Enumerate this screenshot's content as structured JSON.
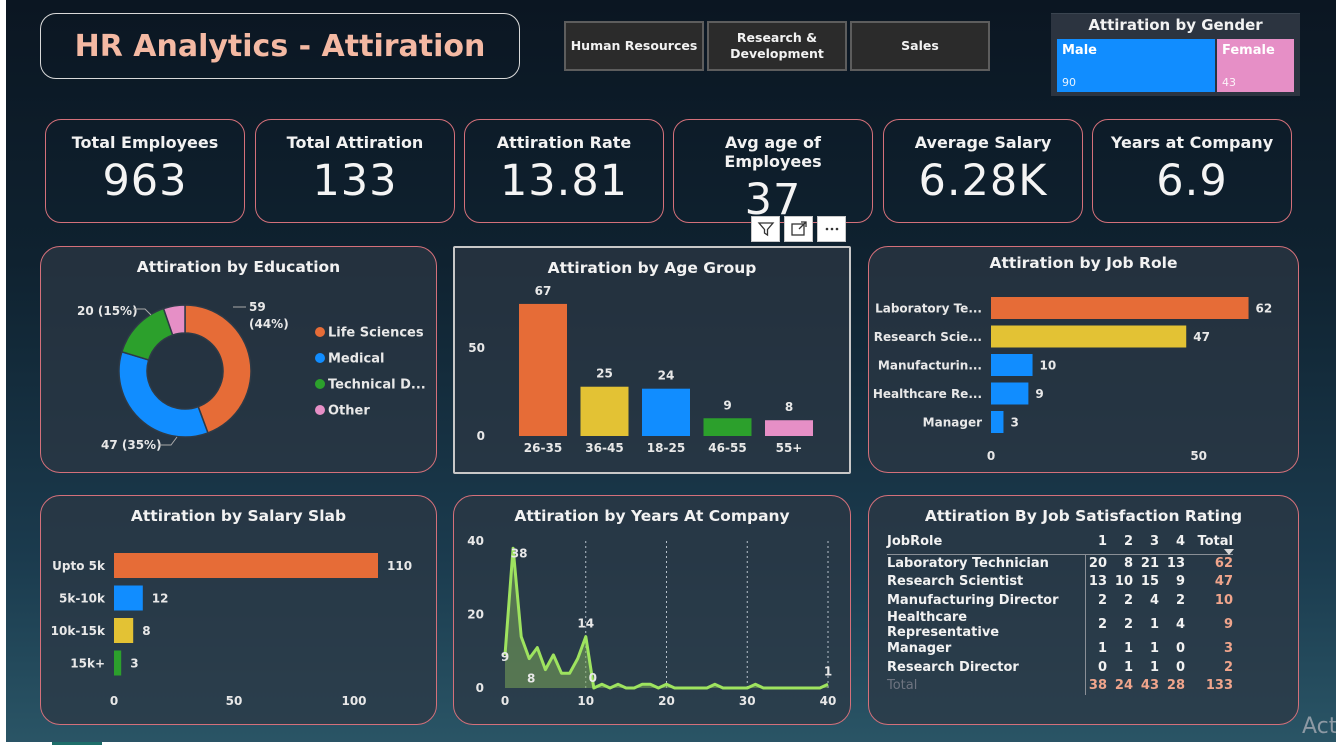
{
  "title": "HR Analytics - Attiration",
  "departments": [
    "Human Resources",
    "Research &\nDevelopment",
    "Sales"
  ],
  "gender": {
    "title": "Attiration by Gender",
    "items": [
      {
        "label": "Male",
        "value": 90,
        "color": "#118dff"
      },
      {
        "label": "Female",
        "value": 43,
        "color": "#e68fc6"
      }
    ]
  },
  "kpis": [
    {
      "label": "Total Employees",
      "value": "963"
    },
    {
      "label": "Total Attiration",
      "value": "133"
    },
    {
      "label": "Attiration Rate",
      "value": "13.81"
    },
    {
      "label": "Avg age of Employees",
      "value": "37"
    },
    {
      "label": "Average Salary",
      "value": "6.28K"
    },
    {
      "label": "Years at Company",
      "value": "6.9"
    }
  ],
  "visual_toolbar": [
    "filter-icon",
    "focus-mode-icon",
    "more-options-icon"
  ],
  "watermark": "Act",
  "chart_data": [
    {
      "type": "pie",
      "title": "Attiration by Education",
      "categories": [
        "Life Sciences",
        "Medical",
        "Technical D...",
        "Other"
      ],
      "values": [
        59,
        47,
        20,
        7
      ],
      "labels": [
        "59\n(44%)",
        "47 (35%)",
        "20 (15%)",
        ""
      ],
      "colors": [
        "#e66c37",
        "#118dff",
        "#2ca02c",
        "#e68fc6"
      ],
      "legend": "right"
    },
    {
      "type": "bar",
      "title": "Attiration by Age Group",
      "categories": [
        "26-35",
        "36-45",
        "18-25",
        "46-55",
        "55+"
      ],
      "values": [
        67,
        25,
        24,
        9,
        8
      ],
      "colors": [
        "#e66c37",
        "#e3c234",
        "#118dff",
        "#2ca02c",
        "#e68fc6"
      ],
      "yticks": [
        "0",
        "50"
      ],
      "ylim": [
        0,
        70
      ]
    },
    {
      "type": "bar",
      "orientation": "horizontal",
      "title": "Attiration by Job Role",
      "categories": [
        "Laboratory Te...",
        "Research Scie...",
        "Manufacturin...",
        "Healthcare Re...",
        "Manager"
      ],
      "values": [
        62,
        47,
        10,
        9,
        3
      ],
      "colors": [
        "#e66c37",
        "#e3c234",
        "#118dff",
        "#118dff",
        "#118dff"
      ],
      "xticks": [
        "0",
        "50"
      ],
      "xlim": [
        0,
        65
      ]
    },
    {
      "type": "bar",
      "orientation": "horizontal",
      "title": "Attiration by Salary Slab",
      "categories": [
        "Upto 5k",
        "5k-10k",
        "10k-15k",
        "15k+"
      ],
      "values": [
        110,
        12,
        8,
        3
      ],
      "colors": [
        "#e66c37",
        "#118dff",
        "#e3c234",
        "#2ca02c"
      ],
      "xticks": [
        "0",
        "50",
        "100"
      ],
      "xlim": [
        0,
        112
      ]
    },
    {
      "type": "area",
      "title": "Attiration by Years At Company",
      "x": [
        0,
        1,
        2,
        3,
        4,
        5,
        6,
        7,
        8,
        9,
        10,
        11,
        12,
        13,
        14,
        15,
        16,
        17,
        18,
        19,
        20,
        21,
        22,
        23,
        24,
        25,
        26,
        27,
        28,
        29,
        30,
        31,
        32,
        33,
        34,
        35,
        36,
        37,
        38,
        39,
        40
      ],
      "values": [
        9,
        38,
        14,
        8,
        11,
        5,
        9,
        4,
        4,
        8,
        14,
        0,
        1,
        0,
        1,
        0,
        0,
        1,
        1,
        0,
        1,
        0,
        0,
        0,
        0,
        0,
        1,
        0,
        0,
        0,
        0,
        1,
        0,
        0,
        0,
        0,
        0,
        0,
        0,
        0,
        1
      ],
      "labeled_points": [
        [
          0,
          "9"
        ],
        [
          1,
          "38"
        ],
        [
          3,
          "8"
        ],
        [
          10,
          "14"
        ],
        [
          11,
          "0"
        ],
        [
          40,
          "1"
        ]
      ],
      "line_color": "#9ee35f",
      "yticks": [
        "0",
        "20",
        "40"
      ],
      "xticks": [
        "0",
        "10",
        "20",
        "30",
        "40"
      ],
      "ylim": [
        0,
        40
      ],
      "xlim": [
        0,
        40
      ]
    },
    {
      "type": "table",
      "title": "Attiration By Job Satisfaction Rating",
      "columns": [
        "JobRole",
        "1",
        "2",
        "3",
        "4",
        "Total"
      ],
      "rows": [
        [
          "Laboratory Technician",
          "20",
          "8",
          "21",
          "13",
          "62"
        ],
        [
          "Research Scientist",
          "13",
          "10",
          "15",
          "9",
          "47"
        ],
        [
          "Manufacturing Director",
          "2",
          "2",
          "4",
          "2",
          "10"
        ],
        [
          "Healthcare Representative",
          "2",
          "2",
          "1",
          "4",
          "9"
        ],
        [
          "Manager",
          "1",
          "1",
          "1",
          "0",
          "3"
        ],
        [
          "Research Director",
          "0",
          "1",
          "1",
          "0",
          "2"
        ],
        [
          "Total",
          "38",
          "24",
          "43",
          "28",
          "133"
        ]
      ]
    }
  ]
}
